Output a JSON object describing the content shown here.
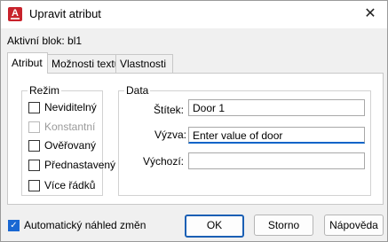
{
  "window": {
    "title": "Upravit atribut",
    "close_glyph": "✕"
  },
  "active_block": "Aktivní blok: bl1",
  "tabs": [
    {
      "label": "Atribut",
      "active": true
    },
    {
      "label": "Možnosti textu",
      "active": false
    },
    {
      "label": "Vlastnosti",
      "active": false
    }
  ],
  "mode": {
    "legend": "Režim",
    "options": [
      {
        "label": "Neviditelný",
        "checked": false,
        "enabled": true
      },
      {
        "label": "Konstantní",
        "checked": false,
        "enabled": false
      },
      {
        "label": "Ověřovaný",
        "checked": false,
        "enabled": true
      },
      {
        "label": "Přednastavený",
        "checked": false,
        "enabled": true
      },
      {
        "label": "Více řádků",
        "checked": false,
        "enabled": true
      }
    ]
  },
  "data": {
    "legend": "Data",
    "tag_label": "Štítek:",
    "tag_value": "Door 1",
    "prompt_label": "Výzva:",
    "prompt_value": "Enter value of door",
    "default_label": "Výchozí:",
    "default_value": ""
  },
  "auto_preview": {
    "label": "Automatický náhled změn",
    "checked": true
  },
  "buttons": {
    "ok": "OK",
    "cancel": "Storno",
    "help": "Nápověda"
  },
  "icons": {
    "app": "autocad-icon",
    "close": "close-icon",
    "check": "checkmark-icon"
  },
  "colors": {
    "accent": "#1967d2",
    "app_icon": "#c8232c"
  }
}
